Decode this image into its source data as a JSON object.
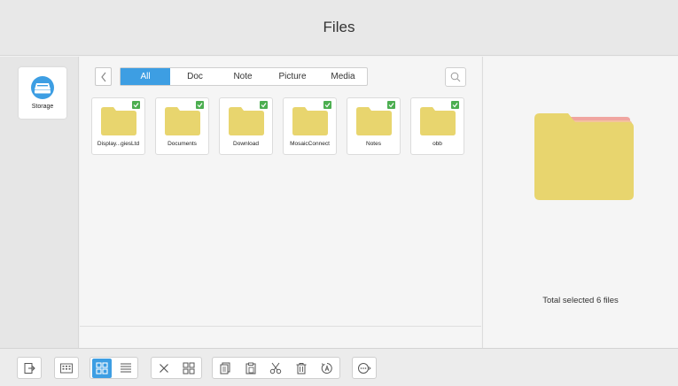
{
  "header": {
    "title": "Files"
  },
  "sidebar": {
    "storage_label": "Storage"
  },
  "tabs": [
    {
      "label": "All",
      "active": true
    },
    {
      "label": "Doc",
      "active": false
    },
    {
      "label": "Note",
      "active": false
    },
    {
      "label": "Picture",
      "active": false
    },
    {
      "label": "Media",
      "active": false
    }
  ],
  "folders": [
    {
      "name": "Display...giesLtd",
      "selected": true
    },
    {
      "name": "Documents",
      "selected": true
    },
    {
      "name": "Download",
      "selected": true
    },
    {
      "name": "MosaicConnect",
      "selected": true
    },
    {
      "name": "Notes",
      "selected": true
    },
    {
      "name": "obb",
      "selected": true
    }
  ],
  "preview": {
    "summary": "Total selected 6 files"
  },
  "colors": {
    "accent": "#3d9ee3",
    "folder": "#e8d56e",
    "check": "#4cae50"
  },
  "toolbar_icons": [
    "exit-icon",
    "keyboard-icon",
    "grid-view-icon",
    "list-view-icon",
    "close-icon",
    "select-all-icon",
    "copy-icon",
    "paste-icon",
    "cut-icon",
    "delete-icon",
    "rename-icon",
    "more-icon"
  ]
}
